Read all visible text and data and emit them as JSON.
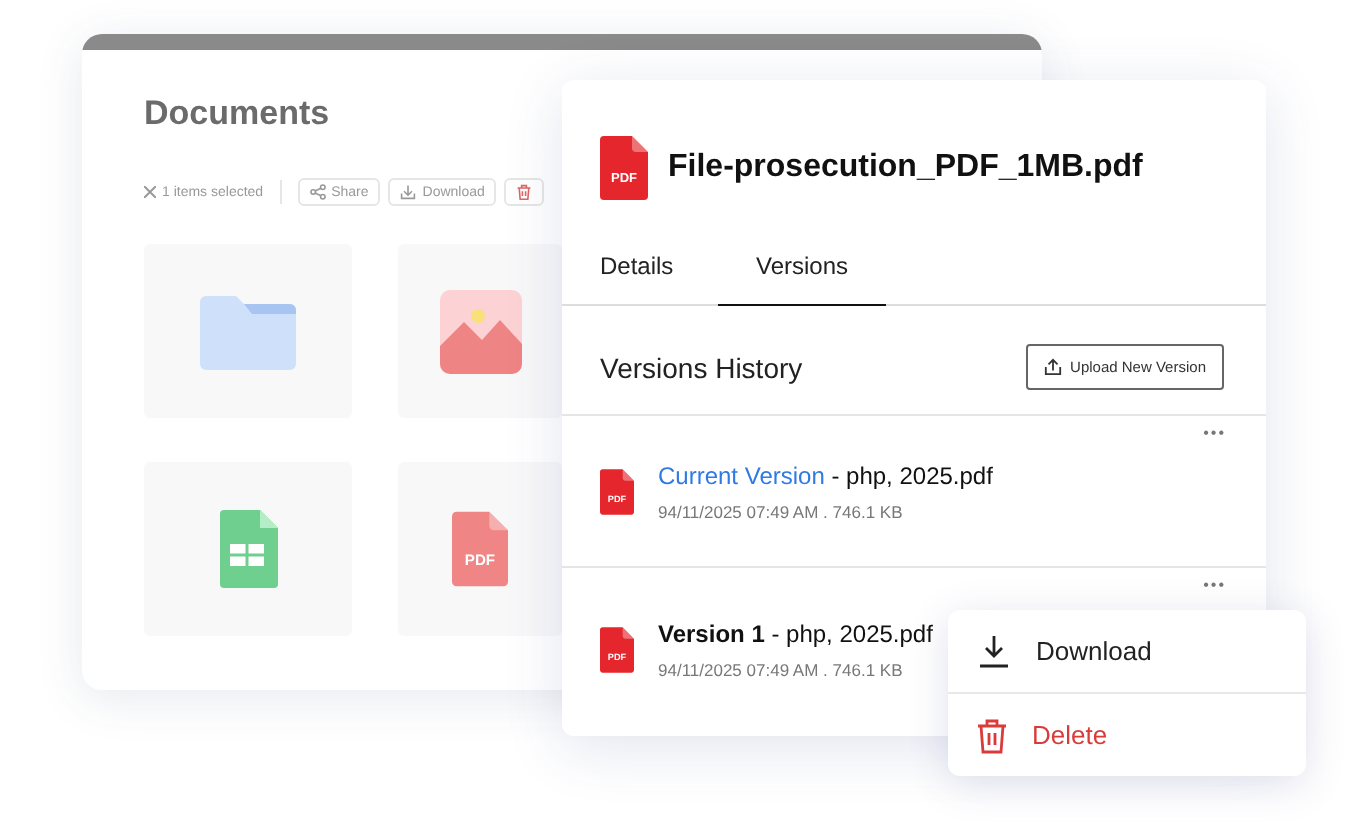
{
  "documents": {
    "title": "Documents",
    "selection": "1 items selected",
    "actions": [
      {
        "kind": "share",
        "label": "Share"
      },
      {
        "kind": "download",
        "label": "Download"
      },
      {
        "kind": "delete"
      }
    ],
    "tiles": [
      {
        "kind": "folder"
      },
      {
        "kind": "image"
      },
      {
        "kind": "sheet"
      },
      {
        "kind": "pdf",
        "badge": "PDF"
      }
    ]
  },
  "panel": {
    "badge": "PDF",
    "file_name": "File-prosecution_PDF_1MB.pdf",
    "tabs": [
      {
        "label": "Details",
        "selected": false
      },
      {
        "label": "Versions",
        "selected": true
      }
    ],
    "section_title": "Versions History",
    "upload_button": "Upload New Version",
    "versions": [
      {
        "badge": "PDF",
        "label": "Current Version",
        "current": true,
        "name": " - php, 2025.pdf",
        "meta": "94/11/2025 07:49 AM . 746.1 KB",
        "menu": "•••"
      },
      {
        "badge": "PDF",
        "label": "Version 1",
        "current": false,
        "name": " - php, 2025.pdf",
        "meta": "94/11/2025 07:49 AM . 746.1 KB",
        "menu": "•••"
      }
    ]
  },
  "context_menu": [
    {
      "kind": "download",
      "label": "Download"
    },
    {
      "kind": "delete",
      "label": "Delete"
    }
  ]
}
